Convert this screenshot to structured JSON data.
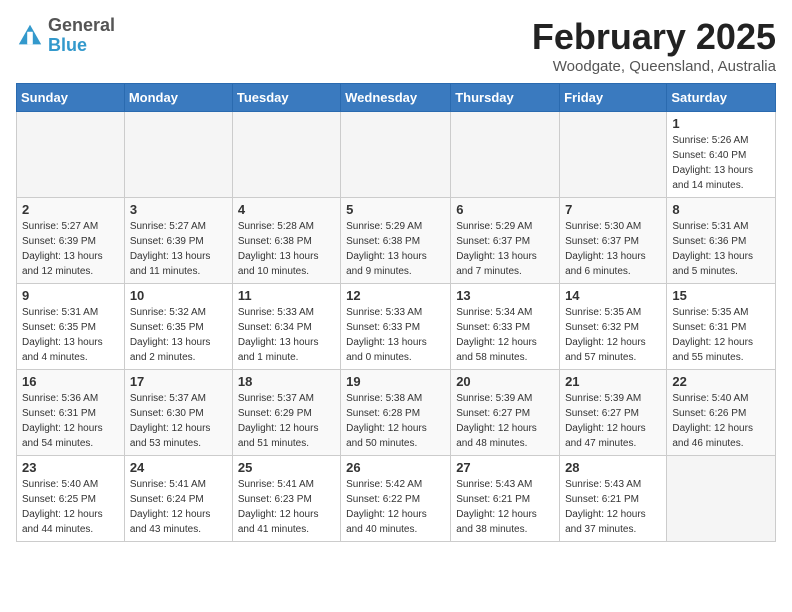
{
  "header": {
    "logo": {
      "general": "General",
      "blue": "Blue"
    },
    "title": "February 2025",
    "subtitle": "Woodgate, Queensland, Australia"
  },
  "weekdays": [
    "Sunday",
    "Monday",
    "Tuesday",
    "Wednesday",
    "Thursday",
    "Friday",
    "Saturday"
  ],
  "weeks": [
    [
      {
        "day": null
      },
      {
        "day": null
      },
      {
        "day": null
      },
      {
        "day": null
      },
      {
        "day": null
      },
      {
        "day": null
      },
      {
        "day": "1",
        "sunrise": "5:26 AM",
        "sunset": "6:40 PM",
        "daylight": "13 hours and 14 minutes."
      }
    ],
    [
      {
        "day": "2",
        "sunrise": "5:27 AM",
        "sunset": "6:39 PM",
        "daylight": "13 hours and 12 minutes."
      },
      {
        "day": "3",
        "sunrise": "5:27 AM",
        "sunset": "6:39 PM",
        "daylight": "13 hours and 11 minutes."
      },
      {
        "day": "4",
        "sunrise": "5:28 AM",
        "sunset": "6:38 PM",
        "daylight": "13 hours and 10 minutes."
      },
      {
        "day": "5",
        "sunrise": "5:29 AM",
        "sunset": "6:38 PM",
        "daylight": "13 hours and 9 minutes."
      },
      {
        "day": "6",
        "sunrise": "5:29 AM",
        "sunset": "6:37 PM",
        "daylight": "13 hours and 7 minutes."
      },
      {
        "day": "7",
        "sunrise": "5:30 AM",
        "sunset": "6:37 PM",
        "daylight": "13 hours and 6 minutes."
      },
      {
        "day": "8",
        "sunrise": "5:31 AM",
        "sunset": "6:36 PM",
        "daylight": "13 hours and 5 minutes."
      }
    ],
    [
      {
        "day": "9",
        "sunrise": "5:31 AM",
        "sunset": "6:35 PM",
        "daylight": "13 hours and 4 minutes."
      },
      {
        "day": "10",
        "sunrise": "5:32 AM",
        "sunset": "6:35 PM",
        "daylight": "13 hours and 2 minutes."
      },
      {
        "day": "11",
        "sunrise": "5:33 AM",
        "sunset": "6:34 PM",
        "daylight": "13 hours and 1 minute."
      },
      {
        "day": "12",
        "sunrise": "5:33 AM",
        "sunset": "6:33 PM",
        "daylight": "13 hours and 0 minutes."
      },
      {
        "day": "13",
        "sunrise": "5:34 AM",
        "sunset": "6:33 PM",
        "daylight": "12 hours and 58 minutes."
      },
      {
        "day": "14",
        "sunrise": "5:35 AM",
        "sunset": "6:32 PM",
        "daylight": "12 hours and 57 minutes."
      },
      {
        "day": "15",
        "sunrise": "5:35 AM",
        "sunset": "6:31 PM",
        "daylight": "12 hours and 55 minutes."
      }
    ],
    [
      {
        "day": "16",
        "sunrise": "5:36 AM",
        "sunset": "6:31 PM",
        "daylight": "12 hours and 54 minutes."
      },
      {
        "day": "17",
        "sunrise": "5:37 AM",
        "sunset": "6:30 PM",
        "daylight": "12 hours and 53 minutes."
      },
      {
        "day": "18",
        "sunrise": "5:37 AM",
        "sunset": "6:29 PM",
        "daylight": "12 hours and 51 minutes."
      },
      {
        "day": "19",
        "sunrise": "5:38 AM",
        "sunset": "6:28 PM",
        "daylight": "12 hours and 50 minutes."
      },
      {
        "day": "20",
        "sunrise": "5:39 AM",
        "sunset": "6:27 PM",
        "daylight": "12 hours and 48 minutes."
      },
      {
        "day": "21",
        "sunrise": "5:39 AM",
        "sunset": "6:27 PM",
        "daylight": "12 hours and 47 minutes."
      },
      {
        "day": "22",
        "sunrise": "5:40 AM",
        "sunset": "6:26 PM",
        "daylight": "12 hours and 46 minutes."
      }
    ],
    [
      {
        "day": "23",
        "sunrise": "5:40 AM",
        "sunset": "6:25 PM",
        "daylight": "12 hours and 44 minutes."
      },
      {
        "day": "24",
        "sunrise": "5:41 AM",
        "sunset": "6:24 PM",
        "daylight": "12 hours and 43 minutes."
      },
      {
        "day": "25",
        "sunrise": "5:41 AM",
        "sunset": "6:23 PM",
        "daylight": "12 hours and 41 minutes."
      },
      {
        "day": "26",
        "sunrise": "5:42 AM",
        "sunset": "6:22 PM",
        "daylight": "12 hours and 40 minutes."
      },
      {
        "day": "27",
        "sunrise": "5:43 AM",
        "sunset": "6:21 PM",
        "daylight": "12 hours and 38 minutes."
      },
      {
        "day": "28",
        "sunrise": "5:43 AM",
        "sunset": "6:21 PM",
        "daylight": "12 hours and 37 minutes."
      },
      {
        "day": null
      }
    ]
  ]
}
